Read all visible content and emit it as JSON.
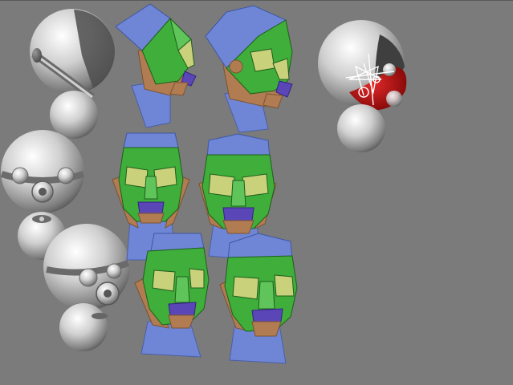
{
  "viewport": {
    "background": "#7b7b7b"
  },
  "palette": {
    "sphere_light": "#e6e6e6",
    "sphere_dark": "#4c4c4c",
    "lowpoly_green": "#3fae3a",
    "lowpoly_yellow": "#c9d27a",
    "lowpoly_blue": "#6f86d6",
    "lowpoly_skin": "#b27c52",
    "lowpoly_purple": "#5b46b8",
    "selection_red": "#b00000",
    "gizmo_white": "#ffffff"
  },
  "models": [
    {
      "name": "sphere-head-side-top",
      "kind": "sphere-head"
    },
    {
      "name": "sphere-head-front",
      "kind": "sphere-head"
    },
    {
      "name": "sphere-head-three-quarter",
      "kind": "sphere-head"
    },
    {
      "name": "sphere-head-selected",
      "kind": "sphere-head",
      "selected": true
    },
    {
      "name": "lowpoly-head-side",
      "kind": "lowpoly-head"
    },
    {
      "name": "lowpoly-head-side-smooth",
      "kind": "lowpoly-head"
    },
    {
      "name": "lowpoly-head-front",
      "kind": "lowpoly-head"
    },
    {
      "name": "lowpoly-head-front-smooth",
      "kind": "lowpoly-head"
    },
    {
      "name": "lowpoly-head-three-quarter",
      "kind": "lowpoly-head"
    },
    {
      "name": "lowpoly-head-three-quarter-smooth",
      "kind": "lowpoly-head"
    }
  ]
}
